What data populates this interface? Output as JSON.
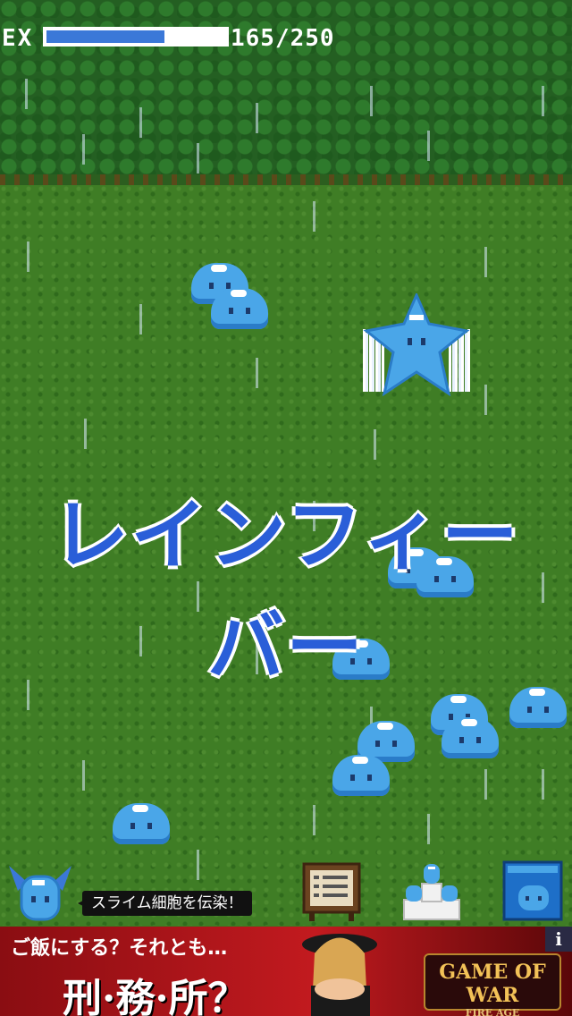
{
  "hud": {
    "ex_label": "EX",
    "ex_current": 165,
    "ex_max": 250,
    "ex_text": "165/250",
    "ex_progress": 0.66
  },
  "banner": {
    "text": "レインフィーバー"
  },
  "enemies": {
    "boss_icon": "winged-star-slime-icon",
    "slime_icon": "blue-slime-icon",
    "slime_count": 13
  },
  "bottom_bar": {
    "tooltip": "スライム細胞を伝染！",
    "buttons": [
      "winged-slime-icon",
      "notice-board-icon",
      "slime-stack-icon",
      "slime-book-icon"
    ]
  },
  "ad": {
    "line1": "ご飯にする？それとも…",
    "line2": "刑·務·所？",
    "logo_title": "GAME OF WAR",
    "logo_sub": "FIRE AGE",
    "info": "i"
  },
  "colors": {
    "accent": "#3b78d8",
    "slime": "#4aa6e8",
    "ad_bg": "#c21a1f",
    "banner_text": "#2a5ed8"
  }
}
